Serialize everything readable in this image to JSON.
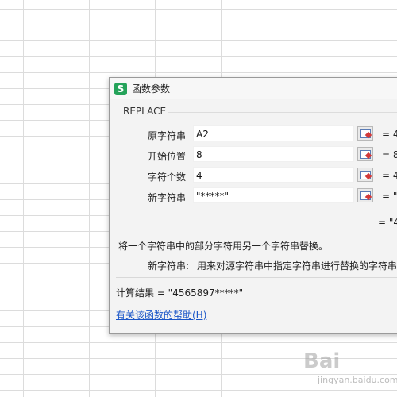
{
  "dialog": {
    "title": "函数参数",
    "app_icon_letter": "S"
  },
  "function_name": "REPLACE",
  "args": [
    {
      "label": "原字符串",
      "value": "A2",
      "result": "= 4"
    },
    {
      "label": "开始位置",
      "value": "8",
      "result": "= 8"
    },
    {
      "label": "字符个数",
      "value": "4",
      "result": "= 4"
    },
    {
      "label": "新字符串",
      "value": "\"*****\"",
      "result": "= \""
    }
  ],
  "overall_result": "= \"4",
  "description": "将一个字符串中的部分字符用另一个字符串替换。",
  "param_desc": {
    "name": "新字符串:",
    "text": "用来对源字符串中指定字符串进行替换的字符串"
  },
  "calc_result": "计算结果 = \"4565897*****\"",
  "help_link": "有关该函数的帮助(H)",
  "watermark": {
    "main": "Bai",
    "sub": "jingyan.baidu.com"
  },
  "colors": {
    "dialog_bg": "#f3f3f3",
    "link": "#1a56c8",
    "app_icon": "#25a35a"
  }
}
